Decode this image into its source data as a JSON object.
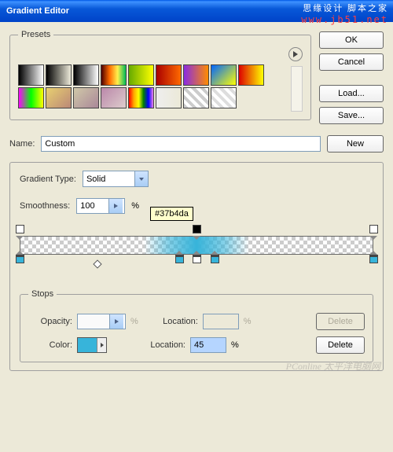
{
  "title": "Gradient Editor",
  "watermark1": "思缘设计 脚本之家",
  "watermark2": "www.jb51.net",
  "watermark3": "PConline  太平洋电脑网",
  "presets_label": "Presets",
  "buttons": {
    "ok": "OK",
    "cancel": "Cancel",
    "load": "Load...",
    "save": "Save...",
    "new": "New",
    "delete": "Delete"
  },
  "name_label": "Name:",
  "name_value": "Custom",
  "gradient_type_label": "Gradient Type:",
  "gradient_type_value": "Solid",
  "smoothness_label": "Smoothness:",
  "smoothness_value": "100",
  "percent": "%",
  "stops_label": "Stops",
  "opacity_label": "Opacity:",
  "opacity_value": "",
  "location_label": "Location:",
  "location_value": "",
  "color_label": "Color:",
  "color_location_value": "45",
  "tooltip": "#37b4da",
  "swatch_color": "#37b4da",
  "preset_gradients_row1": [
    "linear-gradient(to right,#000,#fff)",
    "linear-gradient(to right,#000,transparent)",
    "linear-gradient(to right,#000,#fff)",
    "linear-gradient(to right,#4b0000,#ff6a00,#fff04d,#0b5)",
    "linear-gradient(to right,#6a0,#ff0)",
    "linear-gradient(to right,#a00,#ff6a00)",
    "linear-gradient(to right,#8a2be2,#ff8c00)",
    "linear-gradient(135deg,#06f,#ff0)",
    "linear-gradient(to right,#d00,#ff0)"
  ],
  "preset_gradients_row2": [
    "linear-gradient(to right,#f0f,#0f0,#ff0)",
    "linear-gradient(135deg,#e8d070,#b87)",
    "linear-gradient(135deg,#d0c8a8,#a89)",
    "linear-gradient(135deg,#b8a,#dcc)",
    "linear-gradient(to right,red,orange,yellow,green,blue,violet)",
    "linear-gradient(to right,#eee,transparent)",
    "repeating-linear-gradient(45deg,#ccc 0 4px,#fff 4px 8px)",
    "repeating-linear-gradient(45deg,#ddd 0 4px,#fff 4px 8px)"
  ],
  "opacity_stops": [
    0,
    50,
    100
  ],
  "color_stops": [
    {
      "pos": 0,
      "color": "#37b4da"
    },
    {
      "pos": 45,
      "color": "#37b4da"
    },
    {
      "pos": 50,
      "color": "#fff"
    },
    {
      "pos": 55,
      "color": "#37b4da"
    },
    {
      "pos": 100,
      "color": "#37b4da"
    }
  ],
  "midpoints": [
    22
  ]
}
